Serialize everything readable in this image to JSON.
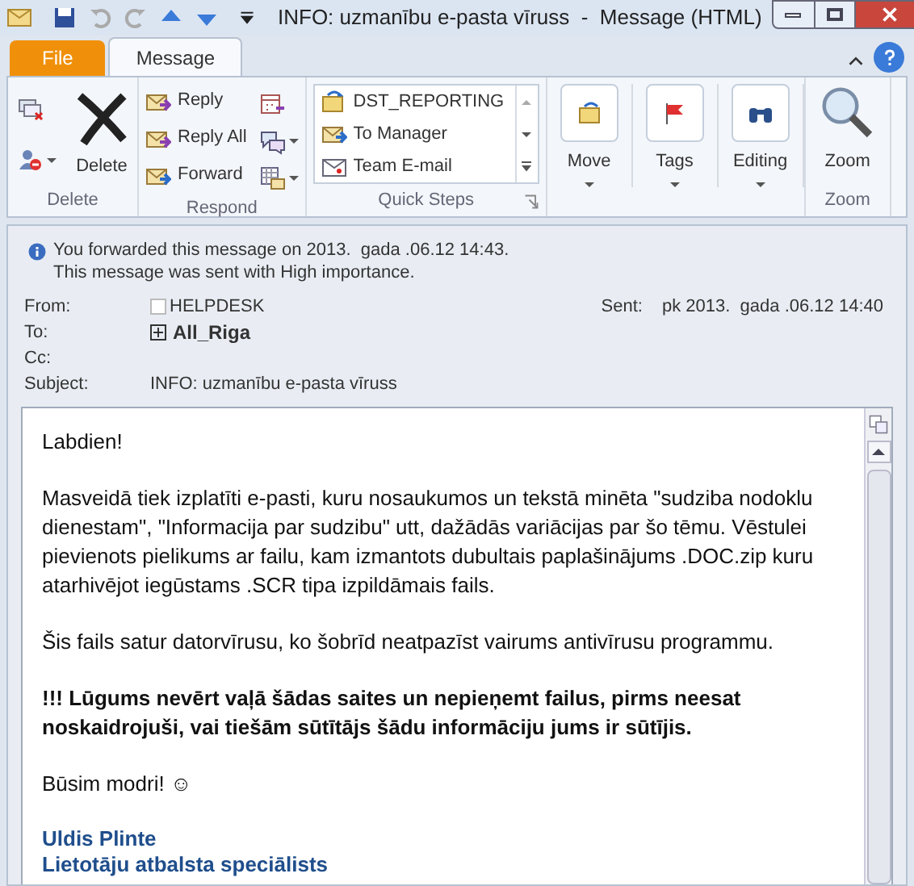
{
  "window": {
    "title": "INFO: uzmanību e-pasta vīruss  -  Message (HTML)"
  },
  "tabs": [
    {
      "label": "File",
      "kind": "file",
      "selected": false
    },
    {
      "label": "Message",
      "kind": "tab",
      "selected": true
    }
  ],
  "ribbon": {
    "groups": [
      {
        "label": "Delete",
        "kind": "delete",
        "buttons": [
          {
            "label": "Delete"
          }
        ]
      },
      {
        "label": "Respond",
        "kind": "respond",
        "buttons": [
          {
            "label": "Reply"
          },
          {
            "label": "Reply All"
          },
          {
            "label": "Forward"
          }
        ]
      },
      {
        "label": "Quick Steps",
        "kind": "quicksteps",
        "buttons": [
          {
            "label": "DST_REPORTING"
          },
          {
            "label": "To Manager"
          },
          {
            "label": "Team E-mail"
          }
        ]
      },
      {
        "kind": "big",
        "buttons": [
          {
            "label": "Move"
          },
          {
            "label": "Tags"
          },
          {
            "label": "Editing"
          }
        ]
      },
      {
        "label": "Zoom",
        "kind": "zoom",
        "buttons": [
          {
            "label": "Zoom"
          }
        ]
      }
    ]
  },
  "infobar": [
    "You forwarded this message on 2013.  gada .06.12 14:43.",
    "This message was sent with High importance."
  ],
  "header": {
    "from_label": "From:",
    "from": "HELPDESK",
    "sent_label": "Sent:",
    "sent": "pk 2013.  gada .06.12 14:40",
    "to_label": "To:",
    "to": "All_Riga",
    "cc_label": "Cc:",
    "subject_label": "Subject:",
    "subject": "INFO: uzmanību e-pasta vīruss"
  },
  "body": [
    {
      "kind": "text",
      "text": "Labdien!"
    },
    {
      "kind": "text",
      "text": "Masveidā tiek izplatīti e-pasti, kuru nosaukumos un tekstā minēta \"sudziba nodoklu dienestam\", \"Informacija par sudzibu\" utt, dažādās variācijas par šo tēmu. Vēstulei pievienots pielikums ar failu, kam izmantots dubultais paplašinājums .DOC.zip kuru atarhivējot iegūstams .SCR tipa izpildāmais fails."
    },
    {
      "kind": "text",
      "text": "Šis fails satur datorvīrusu, ko šobrīd neatpazīst vairums antivīrusu programmu."
    },
    {
      "kind": "bold",
      "text": "!!! Lūgums nevērt vaļā šādas saites un nepieņemt failus, pirms neesat noskaidrojuši, vai tiešām sūtītājs šādu informāciju jums ir sūtījis."
    },
    {
      "kind": "text",
      "text": "Būsim modri! ☺"
    },
    {
      "kind": "signature",
      "lines": [
        "Uldis Plinte",
        "Lietotāju atbalsta speciālists"
      ]
    }
  ]
}
